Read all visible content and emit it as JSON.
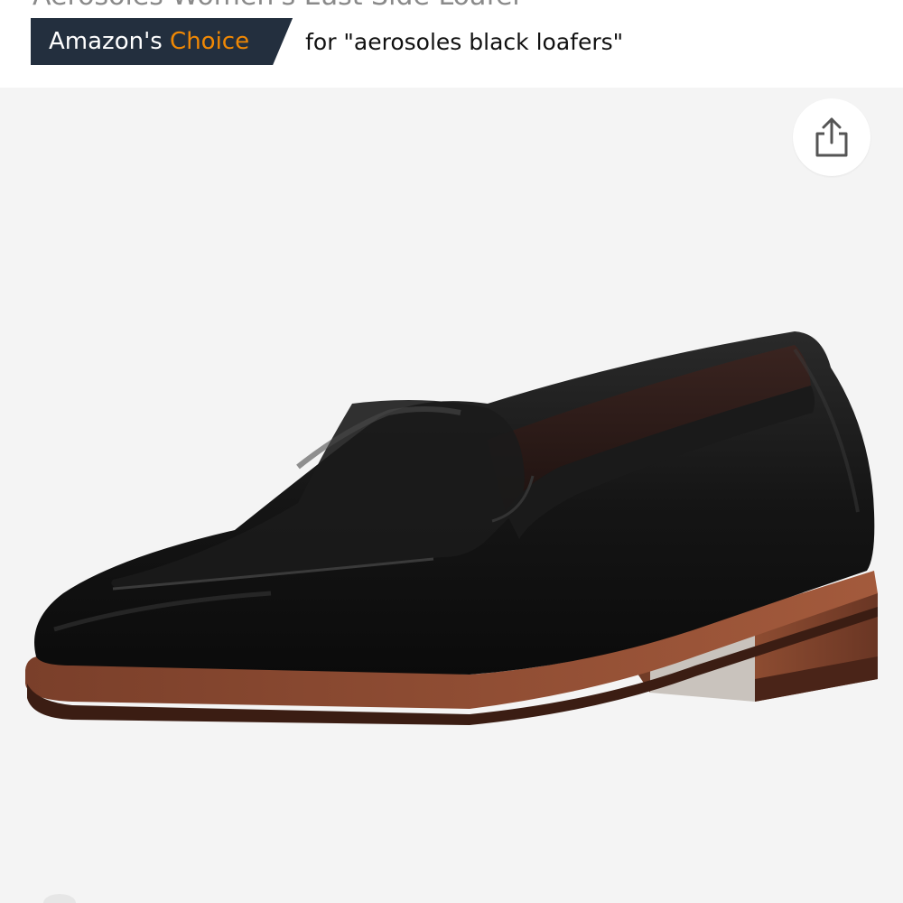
{
  "product": {
    "title": "Aerosoles Women's East Side Loafer"
  },
  "badge": {
    "prefix": "Amazon's",
    "highlight": "Choice",
    "query": "for \"aerosoles black loafers\""
  },
  "colors": {
    "badge_background": "#232f3e",
    "badge_accent": "#f08804",
    "image_background": "#f4f4f4"
  },
  "icons": {
    "share": "share-icon"
  },
  "image": {
    "subject": "black leather loafer with brown stacked heel"
  }
}
